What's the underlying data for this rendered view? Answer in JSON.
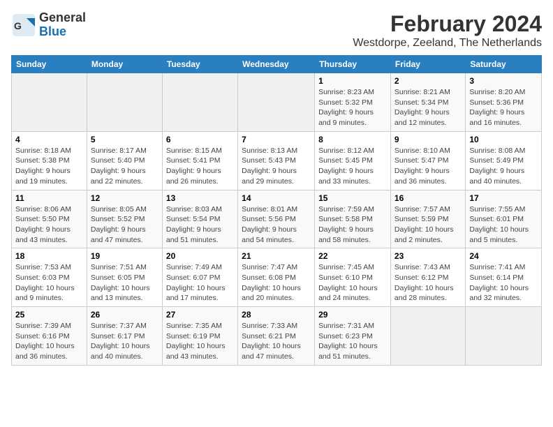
{
  "app": {
    "logo_general": "General",
    "logo_blue": "Blue",
    "main_title": "February 2024",
    "subtitle": "Westdorpe, Zeeland, The Netherlands"
  },
  "calendar": {
    "headers": [
      "Sunday",
      "Monday",
      "Tuesday",
      "Wednesday",
      "Thursday",
      "Friday",
      "Saturday"
    ],
    "rows": [
      [
        {
          "day": "",
          "info": ""
        },
        {
          "day": "",
          "info": ""
        },
        {
          "day": "",
          "info": ""
        },
        {
          "day": "",
          "info": ""
        },
        {
          "day": "1",
          "info": "Sunrise: 8:23 AM\nSunset: 5:32 PM\nDaylight: 9 hours\nand 9 minutes."
        },
        {
          "day": "2",
          "info": "Sunrise: 8:21 AM\nSunset: 5:34 PM\nDaylight: 9 hours\nand 12 minutes."
        },
        {
          "day": "3",
          "info": "Sunrise: 8:20 AM\nSunset: 5:36 PM\nDaylight: 9 hours\nand 16 minutes."
        }
      ],
      [
        {
          "day": "4",
          "info": "Sunrise: 8:18 AM\nSunset: 5:38 PM\nDaylight: 9 hours\nand 19 minutes."
        },
        {
          "day": "5",
          "info": "Sunrise: 8:17 AM\nSunset: 5:40 PM\nDaylight: 9 hours\nand 22 minutes."
        },
        {
          "day": "6",
          "info": "Sunrise: 8:15 AM\nSunset: 5:41 PM\nDaylight: 9 hours\nand 26 minutes."
        },
        {
          "day": "7",
          "info": "Sunrise: 8:13 AM\nSunset: 5:43 PM\nDaylight: 9 hours\nand 29 minutes."
        },
        {
          "day": "8",
          "info": "Sunrise: 8:12 AM\nSunset: 5:45 PM\nDaylight: 9 hours\nand 33 minutes."
        },
        {
          "day": "9",
          "info": "Sunrise: 8:10 AM\nSunset: 5:47 PM\nDaylight: 9 hours\nand 36 minutes."
        },
        {
          "day": "10",
          "info": "Sunrise: 8:08 AM\nSunset: 5:49 PM\nDaylight: 9 hours\nand 40 minutes."
        }
      ],
      [
        {
          "day": "11",
          "info": "Sunrise: 8:06 AM\nSunset: 5:50 PM\nDaylight: 9 hours\nand 43 minutes."
        },
        {
          "day": "12",
          "info": "Sunrise: 8:05 AM\nSunset: 5:52 PM\nDaylight: 9 hours\nand 47 minutes."
        },
        {
          "day": "13",
          "info": "Sunrise: 8:03 AM\nSunset: 5:54 PM\nDaylight: 9 hours\nand 51 minutes."
        },
        {
          "day": "14",
          "info": "Sunrise: 8:01 AM\nSunset: 5:56 PM\nDaylight: 9 hours\nand 54 minutes."
        },
        {
          "day": "15",
          "info": "Sunrise: 7:59 AM\nSunset: 5:58 PM\nDaylight: 9 hours\nand 58 minutes."
        },
        {
          "day": "16",
          "info": "Sunrise: 7:57 AM\nSunset: 5:59 PM\nDaylight: 10 hours\nand 2 minutes."
        },
        {
          "day": "17",
          "info": "Sunrise: 7:55 AM\nSunset: 6:01 PM\nDaylight: 10 hours\nand 5 minutes."
        }
      ],
      [
        {
          "day": "18",
          "info": "Sunrise: 7:53 AM\nSunset: 6:03 PM\nDaylight: 10 hours\nand 9 minutes."
        },
        {
          "day": "19",
          "info": "Sunrise: 7:51 AM\nSunset: 6:05 PM\nDaylight: 10 hours\nand 13 minutes."
        },
        {
          "day": "20",
          "info": "Sunrise: 7:49 AM\nSunset: 6:07 PM\nDaylight: 10 hours\nand 17 minutes."
        },
        {
          "day": "21",
          "info": "Sunrise: 7:47 AM\nSunset: 6:08 PM\nDaylight: 10 hours\nand 20 minutes."
        },
        {
          "day": "22",
          "info": "Sunrise: 7:45 AM\nSunset: 6:10 PM\nDaylight: 10 hours\nand 24 minutes."
        },
        {
          "day": "23",
          "info": "Sunrise: 7:43 AM\nSunset: 6:12 PM\nDaylight: 10 hours\nand 28 minutes."
        },
        {
          "day": "24",
          "info": "Sunrise: 7:41 AM\nSunset: 6:14 PM\nDaylight: 10 hours\nand 32 minutes."
        }
      ],
      [
        {
          "day": "25",
          "info": "Sunrise: 7:39 AM\nSunset: 6:16 PM\nDaylight: 10 hours\nand 36 minutes."
        },
        {
          "day": "26",
          "info": "Sunrise: 7:37 AM\nSunset: 6:17 PM\nDaylight: 10 hours\nand 40 minutes."
        },
        {
          "day": "27",
          "info": "Sunrise: 7:35 AM\nSunset: 6:19 PM\nDaylight: 10 hours\nand 43 minutes."
        },
        {
          "day": "28",
          "info": "Sunrise: 7:33 AM\nSunset: 6:21 PM\nDaylight: 10 hours\nand 47 minutes."
        },
        {
          "day": "29",
          "info": "Sunrise: 7:31 AM\nSunset: 6:23 PM\nDaylight: 10 hours\nand 51 minutes."
        },
        {
          "day": "",
          "info": ""
        },
        {
          "day": "",
          "info": ""
        }
      ]
    ]
  }
}
